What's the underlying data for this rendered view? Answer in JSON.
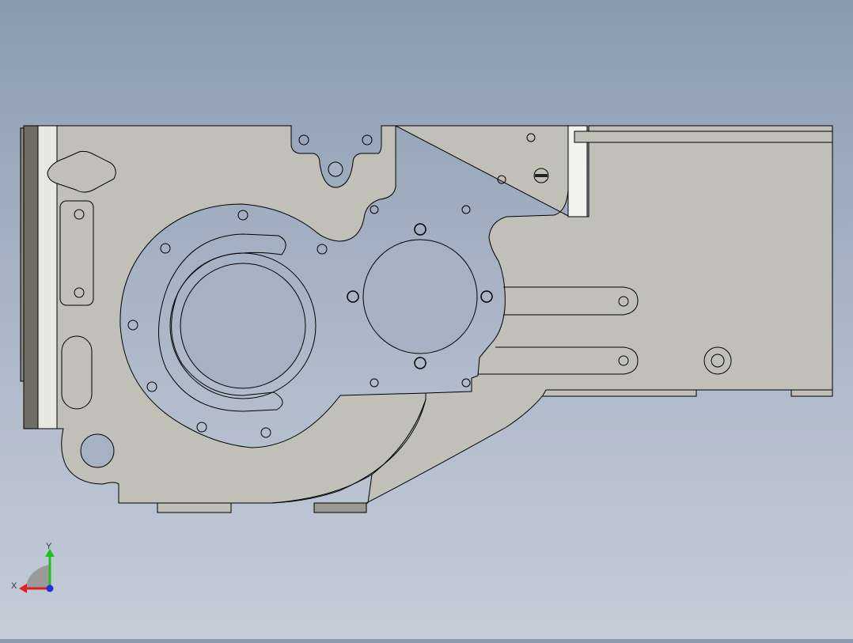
{
  "viewport": {
    "background_top": "#8a9bb0",
    "background_bottom": "#c4ccd8",
    "part_fill": "#c0c0b8",
    "edge_color": "#000000"
  },
  "triad": {
    "x_label": "X",
    "y_label": "Y",
    "x_color": "#e02020",
    "y_color": "#20c020",
    "z_color": "#2030e0"
  }
}
